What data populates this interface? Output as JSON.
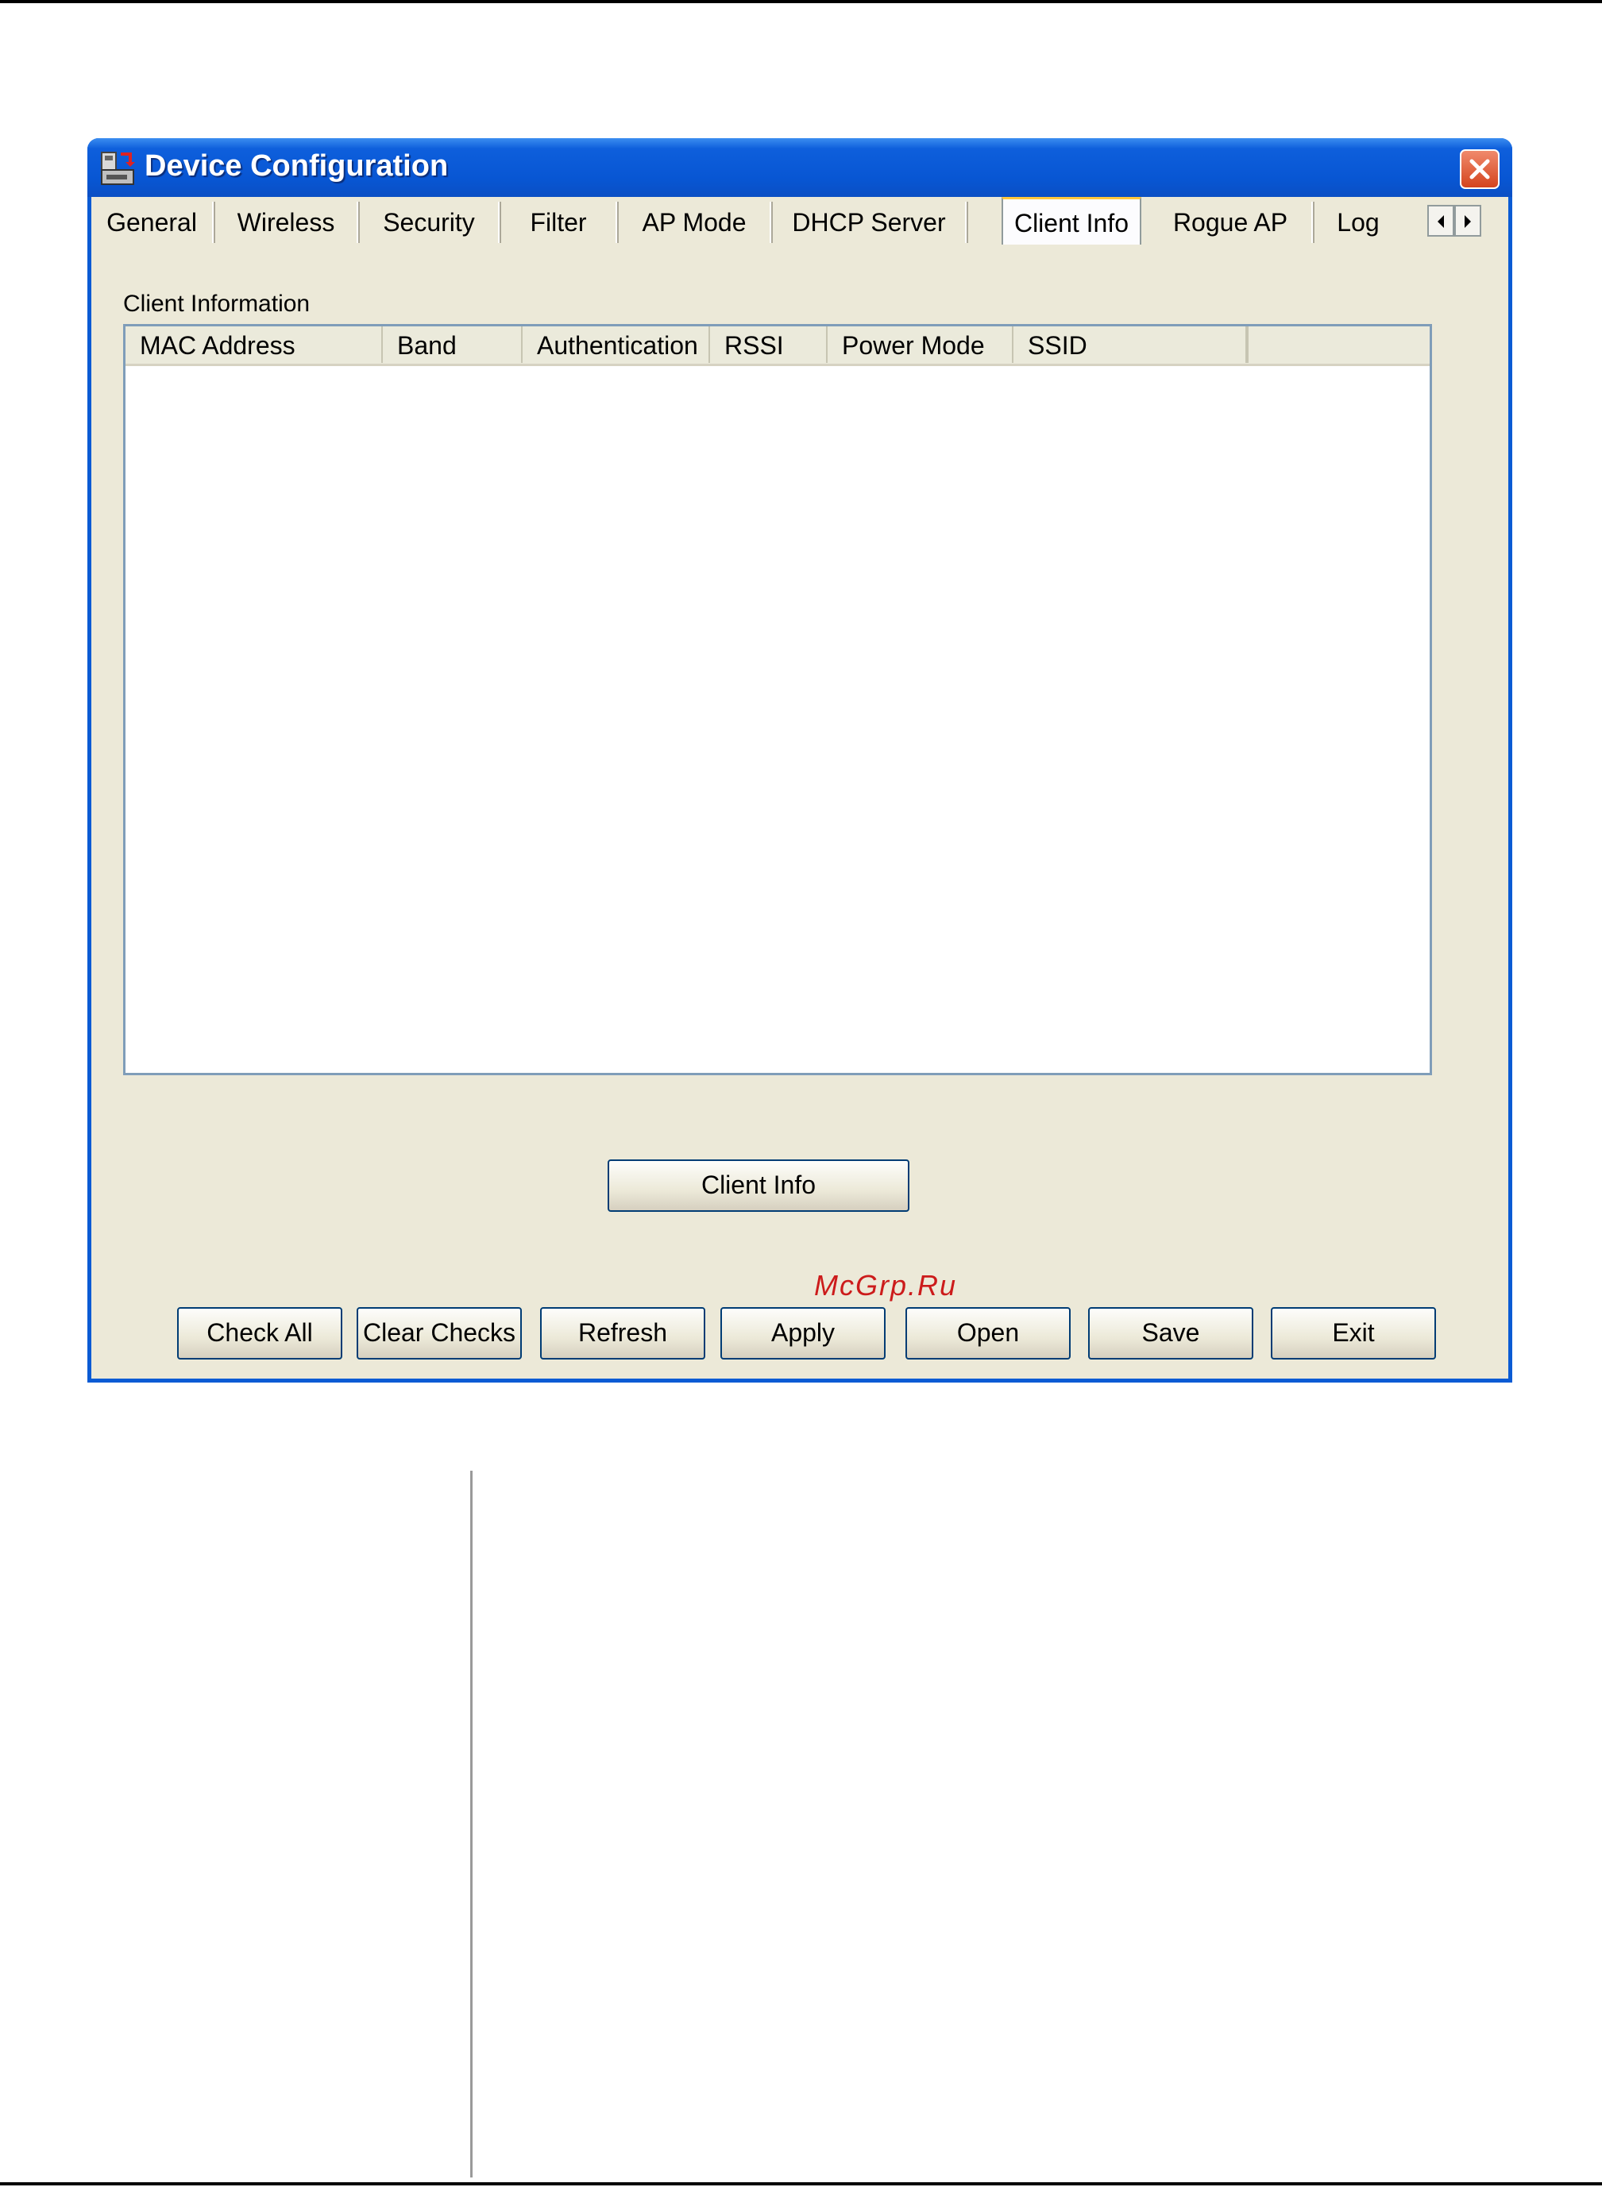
{
  "window": {
    "title": "Device Configuration"
  },
  "tabs": [
    {
      "label": "General"
    },
    {
      "label": "Wireless"
    },
    {
      "label": "Security"
    },
    {
      "label": "Filter"
    },
    {
      "label": "AP Mode"
    },
    {
      "label": "DHCP Server"
    },
    {
      "label": "Client Info",
      "active": true
    },
    {
      "label": "Rogue AP"
    },
    {
      "label": "Log"
    }
  ],
  "client_info": {
    "group_label": "Client Information",
    "columns": [
      "MAC Address",
      "Band",
      "Authentication",
      "RSSI",
      "Power Mode",
      "SSID",
      ""
    ],
    "rows": [],
    "client_info_button": "Client Info"
  },
  "buttons": {
    "check_all": "Check All",
    "clear_checks": "Clear Checks",
    "refresh": "Refresh",
    "apply": "Apply",
    "open": "Open",
    "save": "Save",
    "exit": "Exit"
  },
  "watermark": "McGrp.Ru",
  "colors": {
    "titlebar": "#0856d3",
    "dialog_bg": "#ece9d8",
    "close_button": "#d4441e",
    "active_tab_accent": "#ffc83c",
    "watermark": "#cc1b1b"
  }
}
